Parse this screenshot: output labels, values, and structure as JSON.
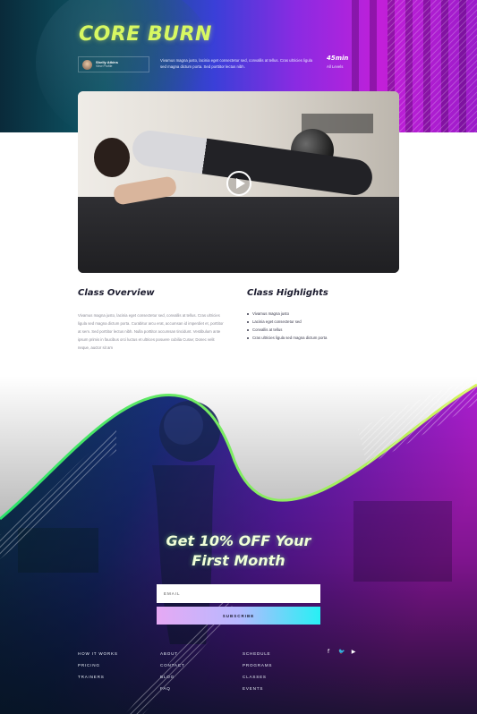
{
  "hero": {
    "title": "CORE BURN",
    "instructor_name": "Shelly Atkins",
    "instructor_role": "View Profile",
    "description": "Vivamus magna justo, lacinia eget consectetur sed, convallis at tellus. Cras ultricies ligula sed magna dictum porta. Sed porttitor lectus nibh.",
    "duration": "45min",
    "level": "All Levels"
  },
  "video": {
    "play_icon": "play-icon"
  },
  "overview": {
    "title": "Class Overview",
    "text": "Vivamus magna justo, lacinia eget consectetur sed, convallis at tellus. Cras ultricies ligula sed magna dictum porta. Curabitur arcu erat, accumsan id imperdiet et, porttitor at sem. Sed porttitor lectus nibh. Nulla porttitor accumsan tincidunt. Vestibulum ante ipsum primis in faucibus orci luctus et ultrices posuere cubilia Curae; Donec velit neque, auctor sit am"
  },
  "highlights": {
    "title": "Class Highlights",
    "items": [
      "Vivamus magna justo",
      "Lacinia eget consectetur sed",
      "Convallis at tellus",
      "Cras ultricies ligula sed magna dictum porta"
    ]
  },
  "promo": {
    "title_line1": "Get 10% OFF Your",
    "title_line2": "First Month",
    "email_placeholder": "EMAIL",
    "subscribe_label": "SUBSCRIBE"
  },
  "footer": {
    "col1": [
      "HOW IT WORKS",
      "PRICING",
      "TRAINERS"
    ],
    "col2": [
      "ABOUT",
      "CONTACT",
      "BLOG",
      "FAQ"
    ],
    "col3": [
      "SCHEDULE",
      "PROGRAMS",
      "CLASSES",
      "EVENTS"
    ],
    "social": [
      {
        "icon": "facebook-icon",
        "glyph": "f"
      },
      {
        "icon": "twitter-icon",
        "glyph": "🐦"
      },
      {
        "icon": "youtube-icon",
        "glyph": "▶"
      }
    ]
  },
  "colors": {
    "accent_lime": "#d7f862",
    "accent_cyan": "#27f0f4",
    "accent_magenta": "#c21fd9"
  }
}
